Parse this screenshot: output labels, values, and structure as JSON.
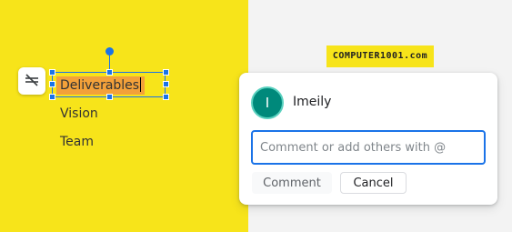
{
  "slide": {
    "background_color": "#f7e41a",
    "selected_text": "Deliverables",
    "bullets": [
      "Vision",
      "Team"
    ],
    "hide_icon": "eye-slash-icon"
  },
  "watermark": {
    "text": "COMPUTER1001.com"
  },
  "comment_card": {
    "avatar_initial": "I",
    "user_name": "Imeily",
    "input_placeholder": "Comment or add others with @",
    "input_value": "",
    "comment_button_label": "Comment",
    "cancel_button_label": "Cancel"
  },
  "colors": {
    "accent": "#1a73e8",
    "avatar": "#00897b",
    "text_highlight": "#f3a13a"
  }
}
